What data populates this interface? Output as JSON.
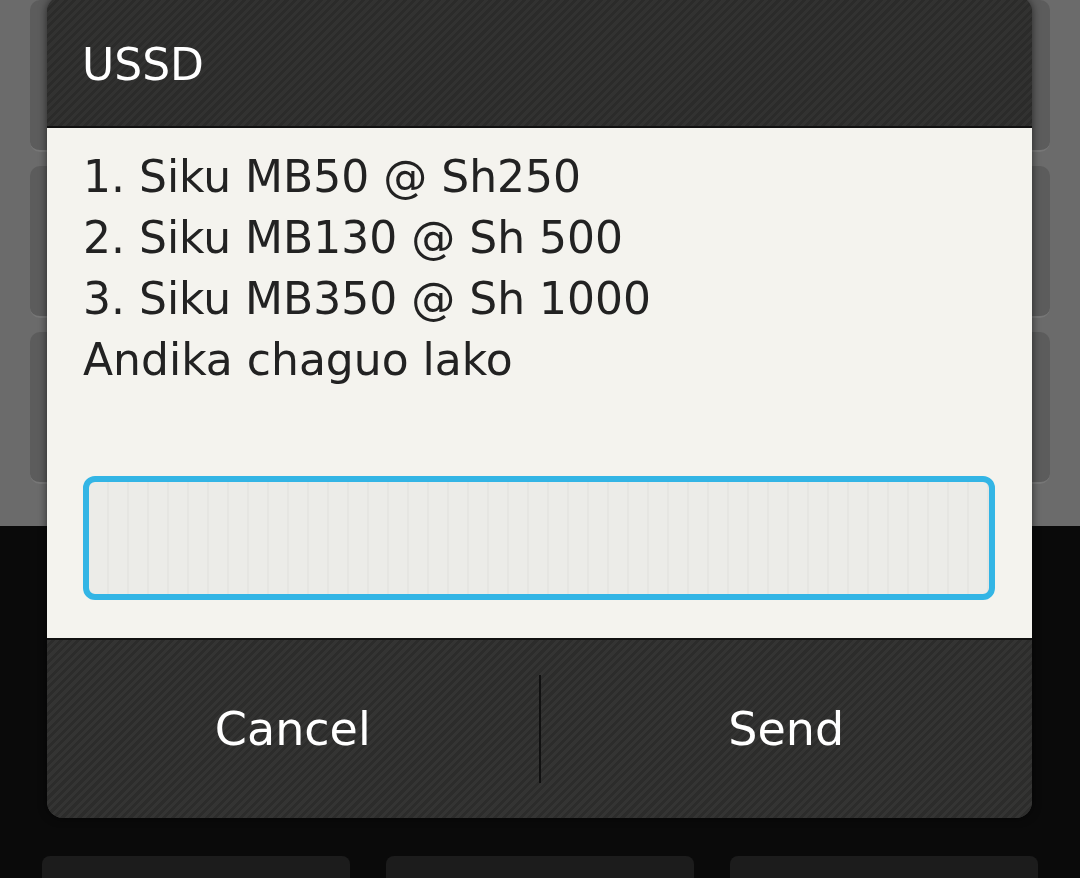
{
  "dialog": {
    "title": "USSD",
    "message_lines": [
      "1. Siku MB50 @ Sh250",
      "2. Siku MB130 @ Sh 500",
      "3. Siku MB350 @ Sh 1000",
      "Andika chaguo lako"
    ],
    "input": {
      "focused": true
    },
    "buttons": [
      {
        "label": "Cancel"
      },
      {
        "label": "Send"
      }
    ]
  }
}
